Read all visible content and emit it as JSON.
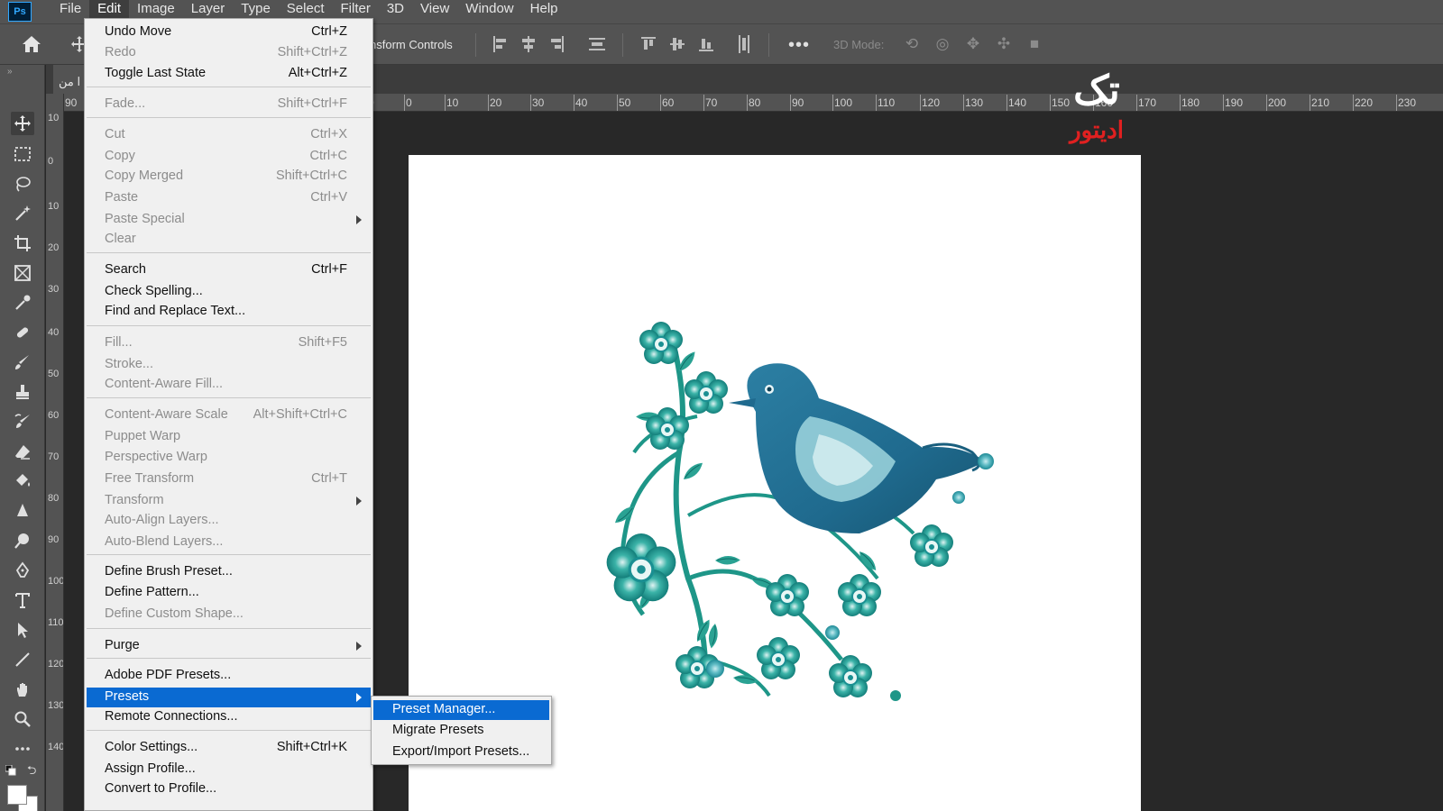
{
  "menubar": {
    "app_icon": "Ps",
    "items": [
      "File",
      "Edit",
      "Image",
      "Layer",
      "Type",
      "Select",
      "Filter",
      "3D",
      "View",
      "Window",
      "Help"
    ],
    "active": "Edit"
  },
  "optionsbar": {
    "transform_label": "nsform Controls",
    "mode3d_label": "3D Mode:",
    "more": "•••"
  },
  "document": {
    "tab_label": "ا من"
  },
  "rulers": {
    "horizontal": [
      "90",
      "0",
      "0",
      "10",
      "20",
      "30",
      "40",
      "50",
      "60",
      "70",
      "80",
      "90",
      "100",
      "110",
      "120",
      "130",
      "140",
      "150",
      "160",
      "170",
      "180",
      "190",
      "200",
      "210",
      "220",
      "230"
    ],
    "vertical": [
      "10",
      "0",
      "10",
      "20",
      "30",
      "40",
      "50",
      "60",
      "70",
      "80",
      "90",
      "100",
      "110",
      "120",
      "130",
      "140"
    ]
  },
  "watermark": {
    "top_text": "تک",
    "bottom_text": "ادیتور"
  },
  "edit_menu": {
    "items": [
      {
        "label": "Undo Move",
        "shortcut": "Ctrl+Z",
        "disabled": false
      },
      {
        "label": "Redo",
        "shortcut": "Shift+Ctrl+Z",
        "disabled": true
      },
      {
        "label": "Toggle Last State",
        "shortcut": "Alt+Ctrl+Z",
        "disabled": false
      },
      {
        "label": "Fade...",
        "shortcut": "Shift+Ctrl+F",
        "disabled": true
      },
      {
        "label": "Cut",
        "shortcut": "Ctrl+X",
        "disabled": true
      },
      {
        "label": "Copy",
        "shortcut": "Ctrl+C",
        "disabled": true
      },
      {
        "label": "Copy Merged",
        "shortcut": "Shift+Ctrl+C",
        "disabled": true
      },
      {
        "label": "Paste",
        "shortcut": "Ctrl+V",
        "disabled": true
      },
      {
        "label": "Paste Special",
        "shortcut": "",
        "disabled": true
      },
      {
        "label": "Clear",
        "shortcut": "",
        "disabled": true
      },
      {
        "label": "Search",
        "shortcut": "Ctrl+F",
        "disabled": false
      },
      {
        "label": "Check Spelling...",
        "shortcut": "",
        "disabled": false
      },
      {
        "label": "Find and Replace Text...",
        "shortcut": "",
        "disabled": false
      },
      {
        "label": "Fill...",
        "shortcut": "Shift+F5",
        "disabled": true
      },
      {
        "label": "Stroke...",
        "shortcut": "",
        "disabled": true
      },
      {
        "label": "Content-Aware Fill...",
        "shortcut": "",
        "disabled": true
      },
      {
        "label": "Content-Aware Scale",
        "shortcut": "Alt+Shift+Ctrl+C",
        "disabled": true
      },
      {
        "label": "Puppet Warp",
        "shortcut": "",
        "disabled": true
      },
      {
        "label": "Perspective Warp",
        "shortcut": "",
        "disabled": true
      },
      {
        "label": "Free Transform",
        "shortcut": "Ctrl+T",
        "disabled": true
      },
      {
        "label": "Transform",
        "shortcut": "",
        "disabled": true
      },
      {
        "label": "Auto-Align Layers...",
        "shortcut": "",
        "disabled": true
      },
      {
        "label": "Auto-Blend Layers...",
        "shortcut": "",
        "disabled": true
      },
      {
        "label": "Define Brush Preset...",
        "shortcut": "",
        "disabled": false
      },
      {
        "label": "Define Pattern...",
        "shortcut": "",
        "disabled": false
      },
      {
        "label": "Define Custom Shape...",
        "shortcut": "",
        "disabled": true
      },
      {
        "label": "Purge",
        "shortcut": "",
        "disabled": false
      },
      {
        "label": "Adobe PDF Presets...",
        "shortcut": "",
        "disabled": false
      },
      {
        "label": "Presets",
        "shortcut": "",
        "disabled": false
      },
      {
        "label": "Remote Connections...",
        "shortcut": "",
        "disabled": false
      },
      {
        "label": "Color Settings...",
        "shortcut": "Shift+Ctrl+K",
        "disabled": false
      },
      {
        "label": "Assign Profile...",
        "shortcut": "",
        "disabled": false
      },
      {
        "label": "Convert to Profile...",
        "shortcut": "",
        "disabled": false
      }
    ]
  },
  "presets_submenu": {
    "items": [
      "Preset Manager...",
      "Migrate Presets",
      "Export/Import Presets..."
    ]
  },
  "colors": {
    "highlight": "#0a6ad2",
    "bird_teal": "#1a8f92",
    "bird_blue": "#2f6f9a",
    "watermark_red": "#e02020"
  }
}
